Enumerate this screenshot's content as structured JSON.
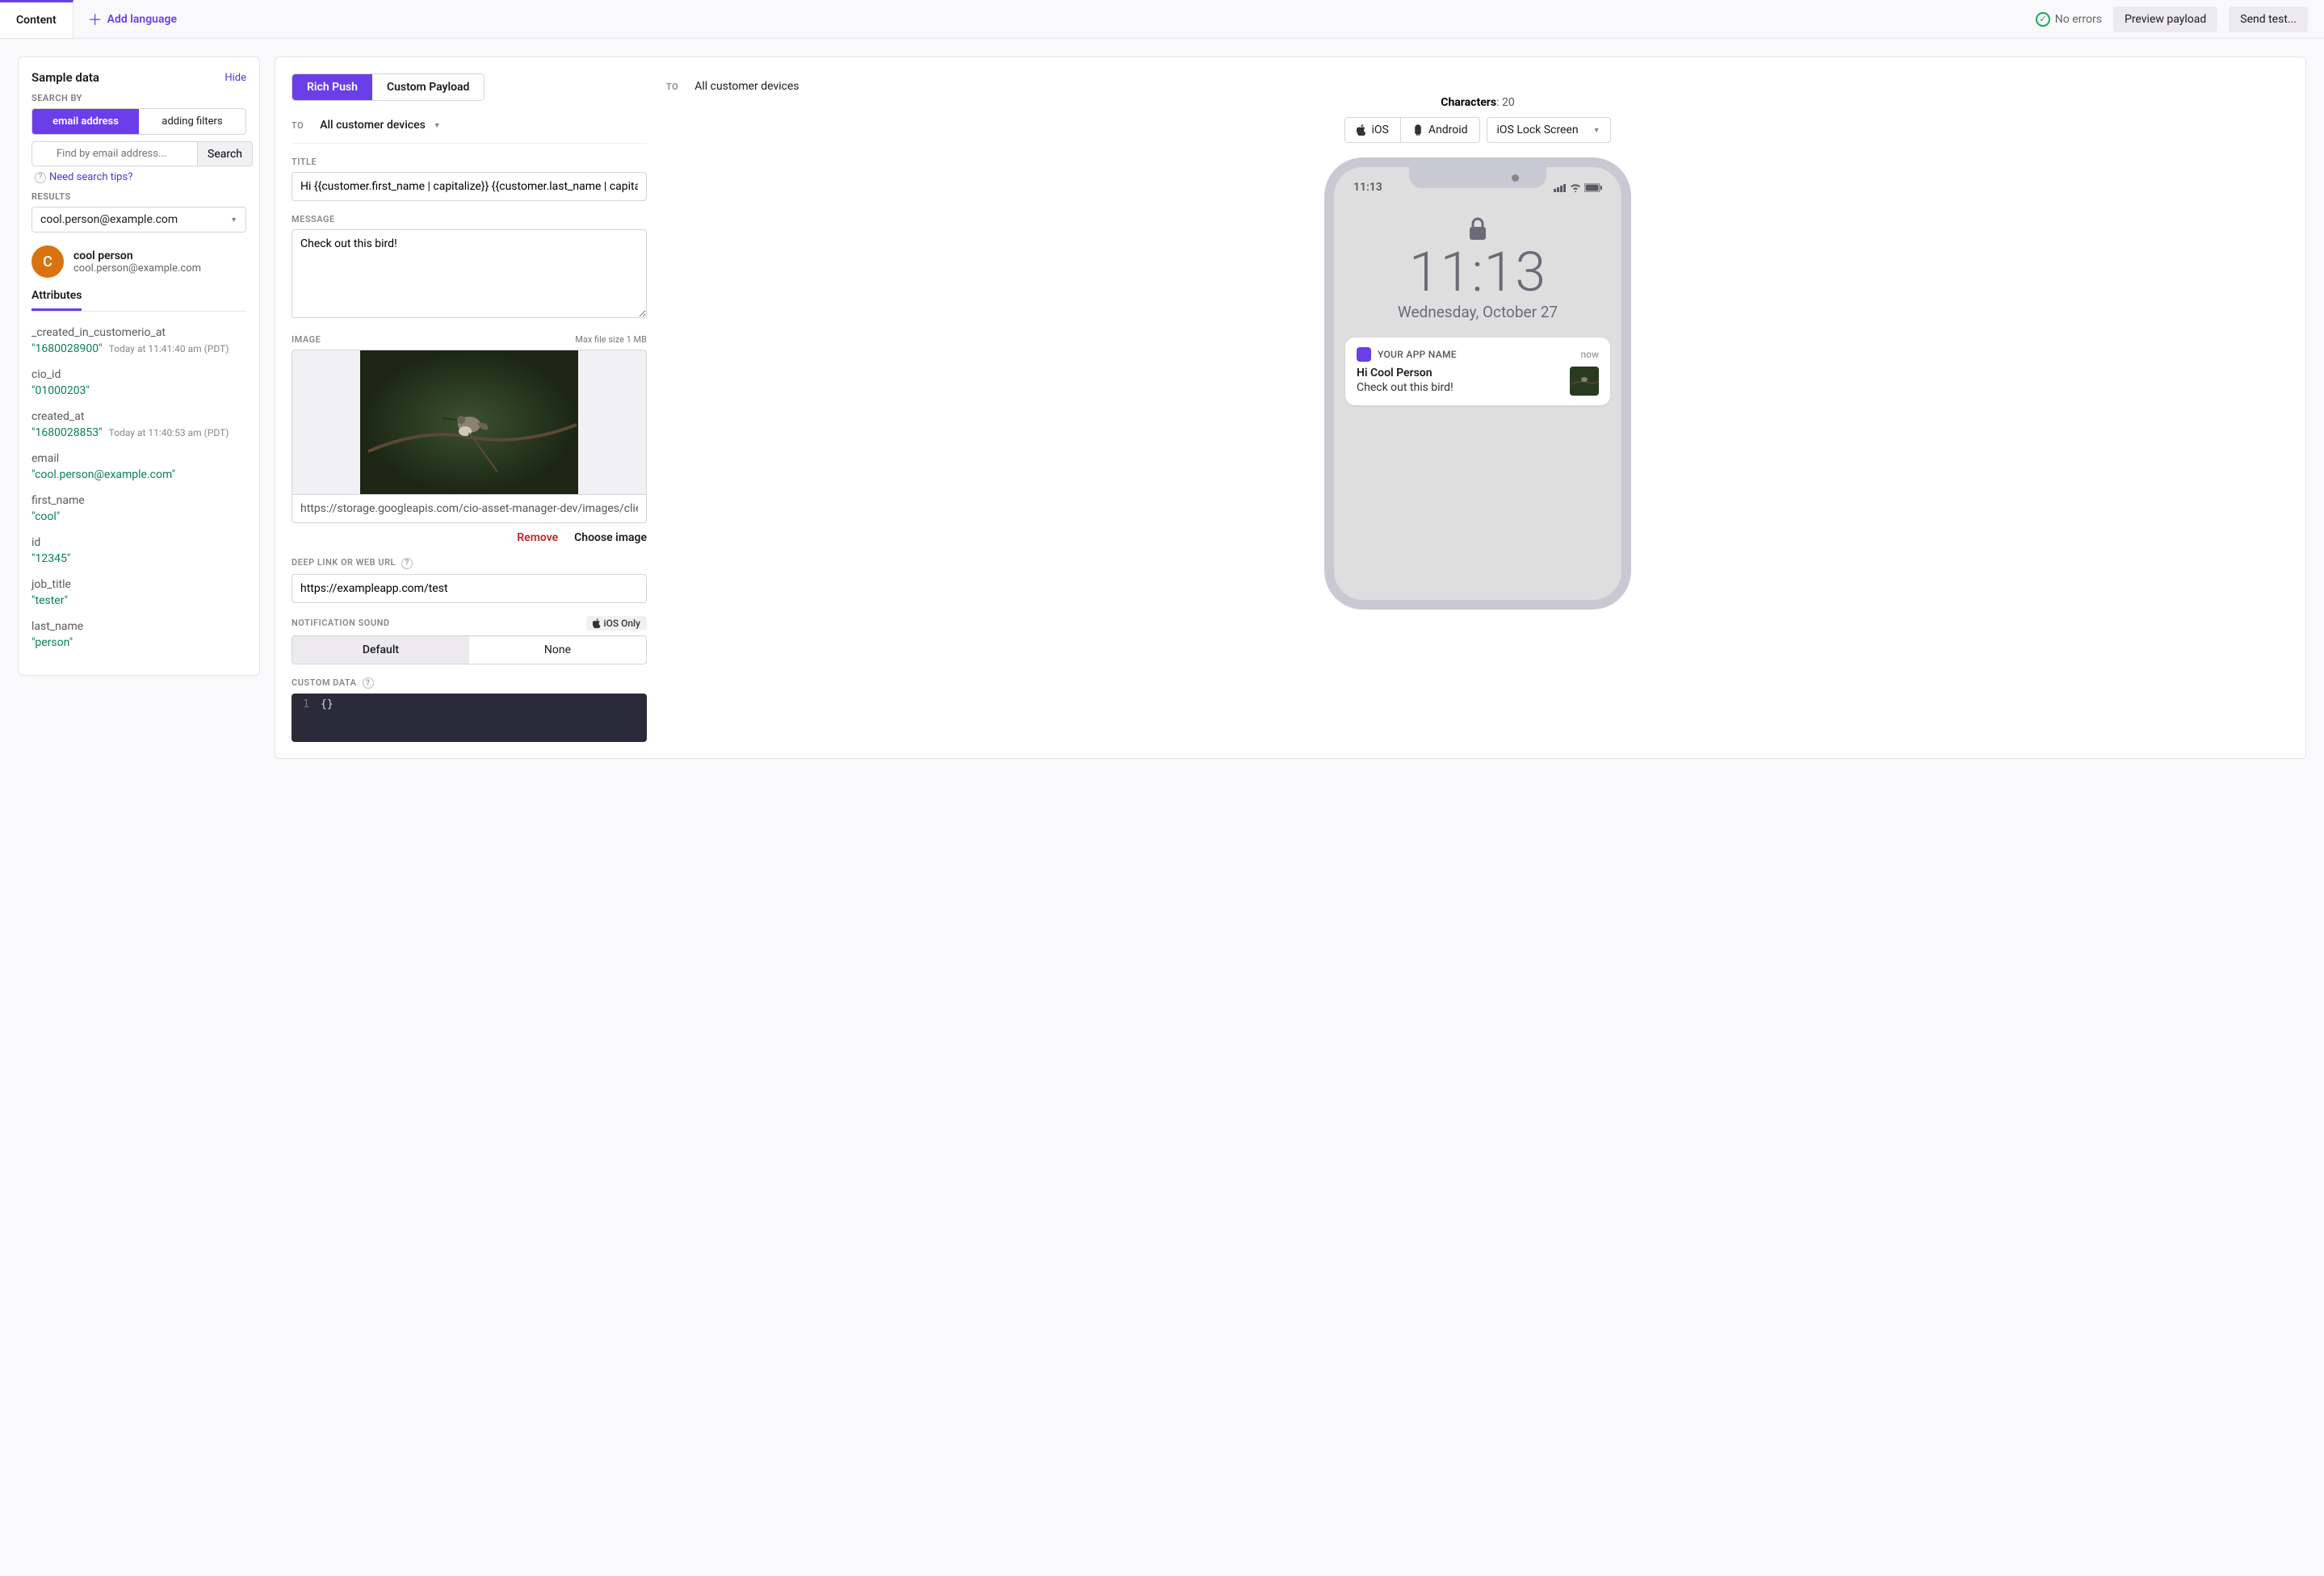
{
  "topbar": {
    "content_tab": "Content",
    "add_language": "Add language",
    "no_errors": "No errors",
    "preview_payload": "Preview payload",
    "send_test": "Send test..."
  },
  "sidebar": {
    "title": "Sample data",
    "hide": "Hide",
    "search_by_label": "SEARCH BY",
    "seg_email": "email address",
    "seg_filters": "adding filters",
    "search_placeholder": "Find by email address...",
    "search_btn": "Search",
    "tips": "Need search tips?",
    "results_label": "RESULTS",
    "results_value": "cool.person@example.com",
    "person_initial": "C",
    "person_name": "cool person",
    "person_email": "cool.person@example.com",
    "attributes_tab": "Attributes",
    "attrs": [
      {
        "key": "_created_in_customerio_at",
        "val": "\"1680028900\"",
        "note": "Today at 11:41:40 am (PDT)"
      },
      {
        "key": "cio_id",
        "val": "\"01000203\"",
        "note": ""
      },
      {
        "key": "created_at",
        "val": "\"1680028853\"",
        "note": "Today at 11:40:53 am (PDT)"
      },
      {
        "key": "email",
        "val": "\"cool.person@example.com\"",
        "note": ""
      },
      {
        "key": "first_name",
        "val": "\"cool\"",
        "note": ""
      },
      {
        "key": "id",
        "val": "\"12345\"",
        "note": ""
      },
      {
        "key": "job_title",
        "val": "\"tester\"",
        "note": ""
      },
      {
        "key": "last_name",
        "val": "\"person\"",
        "note": ""
      }
    ]
  },
  "editor": {
    "type_rich": "Rich Push",
    "type_custom": "Custom Payload",
    "to_label": "TO",
    "to_value": "All customer devices",
    "title_label": "TITLE",
    "title_value": "Hi {{customer.first_name | capitalize}} {{customer.last_name | capitalize}}",
    "message_label": "MESSAGE",
    "message_value": "Check out this bird!",
    "image_label": "IMAGE",
    "image_maxsize": "Max file size 1 MB",
    "image_url": "https://storage.googleapis.com/cio-asset-manager-dev/images/client-",
    "remove": "Remove",
    "choose": "Choose image",
    "deeplink_label": "DEEP LINK OR WEB URL",
    "deeplink_value": "https://exampleapp.com/test",
    "sound_label": "NOTIFICATION SOUND",
    "ios_only": "iOS Only",
    "sound_default": "Default",
    "sound_none": "None",
    "custom_data_label": "CUSTOM DATA",
    "custom_data_value": "{}"
  },
  "preview": {
    "to_label": "TO",
    "to_value": "All customer devices",
    "characters_label": "Characters",
    "characters_count": "20",
    "platform_ios": "iOS",
    "platform_android": "Android",
    "view_mode": "iOS Lock Screen",
    "phone": {
      "status_time": "11:13",
      "big_time": "11:13",
      "date": "Wednesday, October 27",
      "app_name": "YOUR APP NAME",
      "when": "now",
      "notif_title": "Hi Cool Person",
      "notif_msg": "Check out this bird!"
    }
  }
}
